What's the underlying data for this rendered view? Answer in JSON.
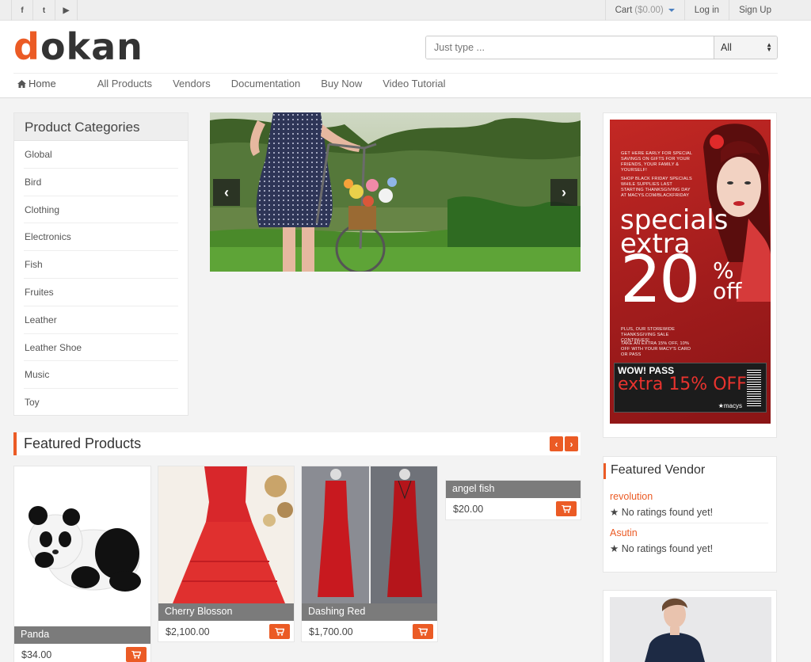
{
  "topbar": {
    "social_icons": [
      "facebook-icon",
      "twitter-icon",
      "youtube-icon"
    ],
    "social_glyphs": {
      "facebook": "f",
      "twitter": "t",
      "youtube": "▶"
    },
    "cart_label": "Cart",
    "cart_amount": "($0.00)",
    "login": "Log in",
    "signup": "Sign Up"
  },
  "header": {
    "logo_first": "d",
    "logo_rest": "okan",
    "search_placeholder": "Just type ...",
    "search_category": "All"
  },
  "nav": {
    "home": "Home",
    "items": [
      "All Products",
      "Vendors",
      "Documentation",
      "Buy Now",
      "Video Tutorial"
    ]
  },
  "categories": {
    "title": "Product Categories",
    "items": [
      "Global",
      "Bird",
      "Clothing",
      "Electronics",
      "Fish",
      "Fruites",
      "Leather",
      "Leather Shoe",
      "Music",
      "Toy"
    ]
  },
  "featured": {
    "title": "Featured Products",
    "products": [
      {
        "name": "Panda",
        "price": "$34.00"
      },
      {
        "name": "Cherry Blosson",
        "price": "$2,100.00"
      },
      {
        "name": "Dashing Red",
        "price": "$1,700.00"
      },
      {
        "name": "angel fish",
        "price": "$20.00"
      }
    ]
  },
  "ad": {
    "text1": "GET HERE EARLY FOR SPECIAL SAVINGS ON GIFTS FOR YOUR FRIENDS, YOUR FAMILY & YOURSELF!",
    "text2": "SHOP BLACK FRIDAY SPECIALS WHILE SUPPLIES LAST STARTING THANKSGIVING DAY AT MACYS.COM/BLACKFRIDAY",
    "big1": "specials",
    "big2": "extra",
    "pct": "20",
    "pct_sign": "%",
    "off": "off",
    "text3": "PLUS, OUR STOREWIDE THANKSGIVING SALE CONTINUES!",
    "text4": "TAKE AN EXTRA 15% OFF, 10% OFF WITH YOUR MACY'S CARD OR PASS",
    "wow": "WOW! PASS",
    "coupon": "extra 15% OFF",
    "brand": "★macys"
  },
  "vendor": {
    "title": "Featured Vendor",
    "items": [
      {
        "name": "revolution",
        "rating": "No ratings found yet!"
      },
      {
        "name": "Asutin",
        "rating": "No ratings found yet!"
      }
    ]
  },
  "colors": {
    "accent": "#eb5b25",
    "ad_red": "#b52220"
  }
}
